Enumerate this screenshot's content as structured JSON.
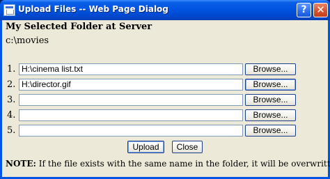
{
  "window": {
    "title": "Upload Files -- Web Page Dialog",
    "help_glyph": "?",
    "close_glyph": "✕"
  },
  "heading": "My Selected Folder at Server",
  "folder_path": "c:\\movies",
  "rows": [
    {
      "num": "1.",
      "value": "H:\\cinema list.txt",
      "browse_label": "Browse..."
    },
    {
      "num": "2.",
      "value": "H:\\director.gif",
      "browse_label": "Browse..."
    },
    {
      "num": "3.",
      "value": "",
      "browse_label": "Browse..."
    },
    {
      "num": "4.",
      "value": "",
      "browse_label": "Browse..."
    },
    {
      "num": "5.",
      "value": "",
      "browse_label": "Browse..."
    }
  ],
  "buttons": {
    "upload_label": "Upload",
    "close_label": "Close"
  },
  "note": {
    "label": "NOTE:",
    "text": " If the file exists with the same name in the folder, it will be overwritten."
  },
  "colors": {
    "title_bar": "#0054e3",
    "dialog_bg": "#ece9d8"
  },
  "icons": [
    "dialog-page-icon",
    "help-icon",
    "close-icon"
  ]
}
